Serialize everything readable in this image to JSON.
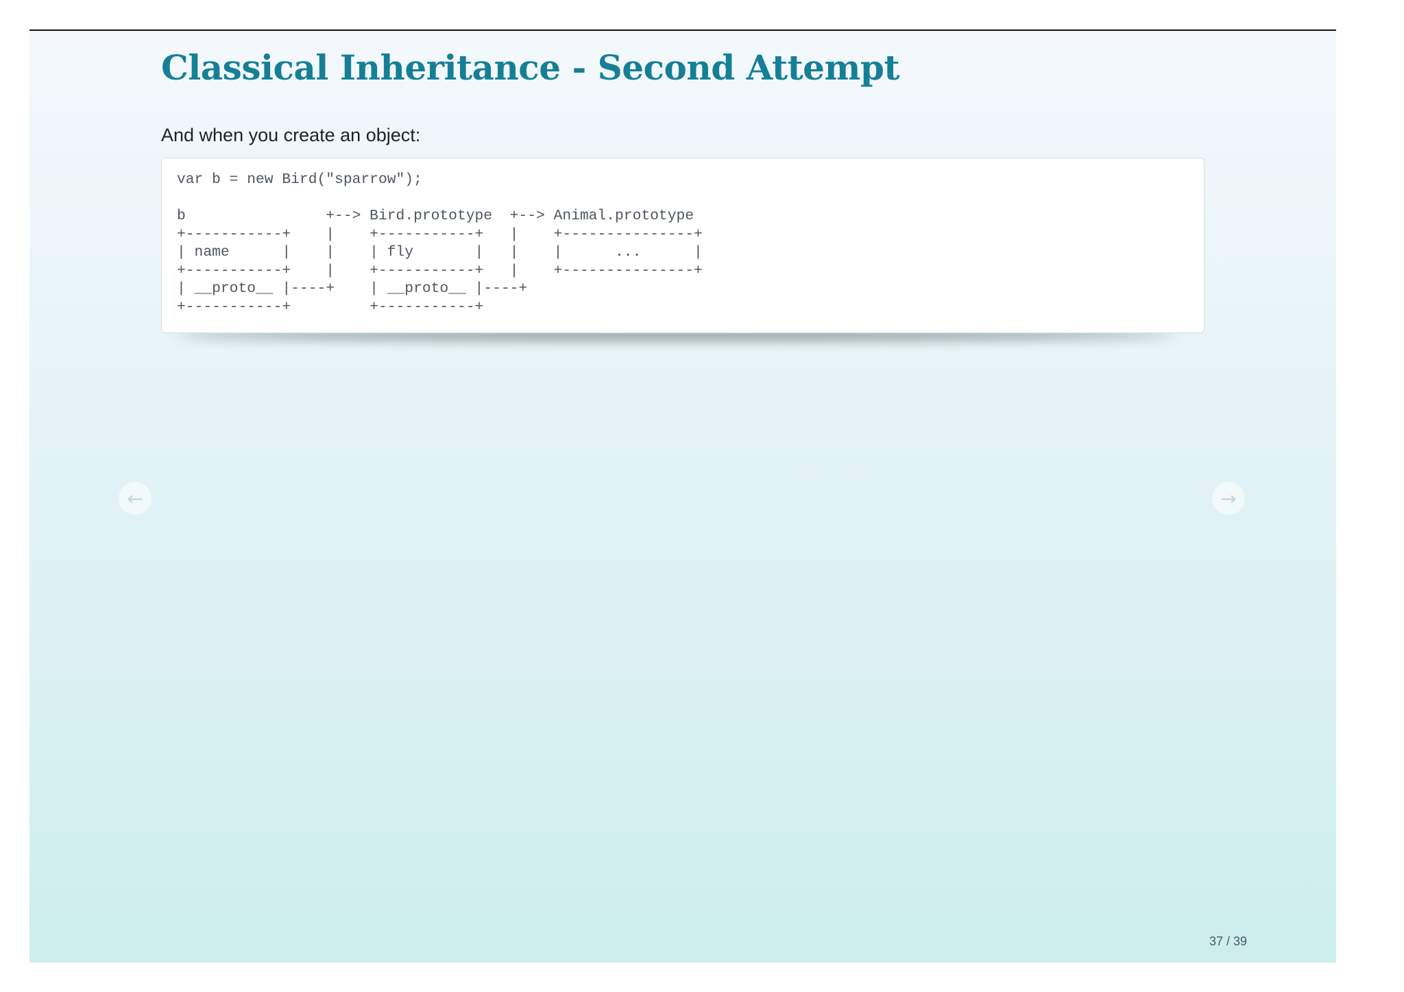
{
  "slide": {
    "title": "Classical Inheritance - Second Attempt",
    "intro": "And when you create an object:",
    "code": "var b = new Bird(\"sparrow\");\n\nb                +--> Bird.prototype  +--> Animal.prototype\n+-----------+    |    +-----------+   |    +---------------+\n| name      |    |    | fly       |   |    |      ...      |\n+-----------+    |    +-----------+   |    +---------------+\n| __proto__ |----+    | __proto__ |----+\n+-----------+         +-----------+",
    "page_counter": "37 / 39"
  },
  "nav": {
    "prev_icon": "left-arrow-icon",
    "prev_glyph": "←",
    "next_icon": "right-arrow-icon",
    "next_glyph": "→"
  }
}
